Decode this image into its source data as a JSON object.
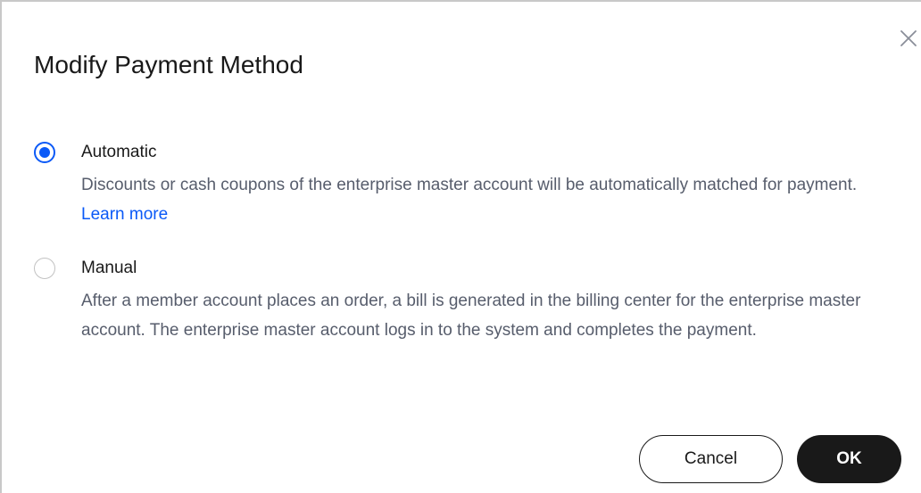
{
  "dialog": {
    "title": "Modify Payment Method",
    "close_icon": "close-icon"
  },
  "options": [
    {
      "label": "Automatic",
      "selected": true,
      "description": "Discounts or cash coupons of the enterprise master account will be automatically matched for payment.",
      "link_text": "Learn more"
    },
    {
      "label": "Manual",
      "selected": false,
      "description": "After a member account places an order, a bill is generated in the billing center for the enterprise master account. The enterprise master account logs in to the system and completes the payment."
    }
  ],
  "buttons": {
    "cancel_label": "Cancel",
    "ok_label": "OK"
  },
  "colors": {
    "accent": "#0a59f7",
    "primary_button": "#191919",
    "description_text": "#575d6c"
  }
}
